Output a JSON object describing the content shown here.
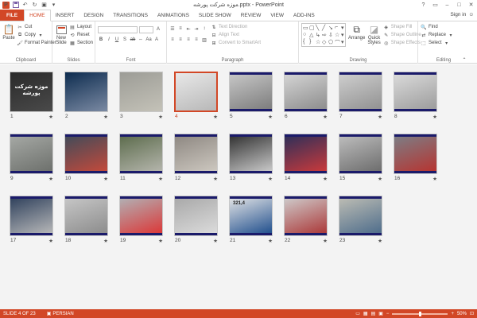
{
  "window": {
    "title": "موزه شرکت پورشه.pptx - PowerPoint",
    "qat_icons": [
      "powerpoint-logo-icon",
      "save-icon",
      "undo-icon",
      "redo-icon",
      "present-icon",
      "customize-icon"
    ],
    "controls": {
      "help": "?",
      "restore": "▭",
      "minimize": "–",
      "maximize": "□",
      "close": "✕"
    }
  },
  "tabs": [
    {
      "label": "FILE",
      "kind": "file"
    },
    {
      "label": "HOME",
      "kind": "active"
    },
    {
      "label": "INSERT"
    },
    {
      "label": "DESIGN"
    },
    {
      "label": "TRANSITIONS"
    },
    {
      "label": "ANIMATIONS"
    },
    {
      "label": "SLIDE SHOW"
    },
    {
      "label": "REVIEW"
    },
    {
      "label": "VIEW"
    },
    {
      "label": "ADD-INS"
    }
  ],
  "signin": "Sign in",
  "ribbon": {
    "clipboard": {
      "label": "Clipboard",
      "paste": "Paste",
      "cut": "Cut",
      "copy": "Copy",
      "format_painter": "Format Painter"
    },
    "slides": {
      "label": "Slides",
      "new_slide": "New",
      "new_slide2": "Slide",
      "layout": "Layout",
      "reset": "Reset",
      "section": "Section"
    },
    "font": {
      "label": "Font"
    },
    "paragraph": {
      "label": "Paragraph",
      "text_direction": "Text Direction",
      "align_text": "Align Text",
      "convert_smartart": "Convert to SmartArt"
    },
    "drawing": {
      "label": "Drawing",
      "arrange": "Arrange",
      "quick_styles": "Quick",
      "quick_styles2": "Styles",
      "shape_fill": "Shape Fill",
      "shape_outline": "Shape Outline",
      "shape_effects": "Shape Effects"
    },
    "editing": {
      "label": "Editing",
      "find": "Find",
      "replace": "Replace",
      "select": "Select"
    }
  },
  "slides": [
    {
      "n": "1",
      "title": "موزه شرکت پورشه"
    },
    {
      "n": "2"
    },
    {
      "n": "3"
    },
    {
      "n": "4",
      "selected": true
    },
    {
      "n": "5"
    },
    {
      "n": "6"
    },
    {
      "n": "7"
    },
    {
      "n": "8"
    },
    {
      "n": "9"
    },
    {
      "n": "10"
    },
    {
      "n": "11"
    },
    {
      "n": "12"
    },
    {
      "n": "13"
    },
    {
      "n": "14"
    },
    {
      "n": "15"
    },
    {
      "n": "16"
    },
    {
      "n": "17"
    },
    {
      "n": "18"
    },
    {
      "n": "19"
    },
    {
      "n": "20"
    },
    {
      "n": "21",
      "caption": "321,4"
    },
    {
      "n": "22"
    },
    {
      "n": "23"
    }
  ],
  "star": "★",
  "status": {
    "slide": "SLIDE 4 OF 23",
    "language": "PERSIAN",
    "zoom": "50%",
    "zoom_fraction": 0.5
  },
  "colors": {
    "accent": "#d24726",
    "navy": "#1a1a6a"
  }
}
